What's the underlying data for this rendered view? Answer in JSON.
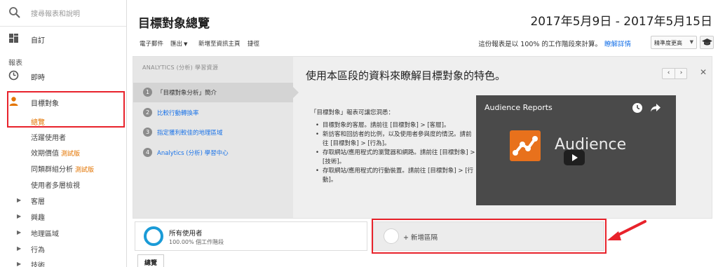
{
  "sidebar": {
    "search_placeholder": "搜尋報表和說明",
    "custom_label": "自訂",
    "section_reports": "報表",
    "realtime_label": "即時",
    "audience_label": "目標對象",
    "audience_items": [
      {
        "label": "總覽",
        "active": true
      },
      {
        "label": "活躍使用者"
      },
      {
        "label": "效期價值",
        "badge": "測試版"
      },
      {
        "label": "同類群組分析",
        "badge": "測試版"
      },
      {
        "label": "使用者多層檢視"
      }
    ],
    "expandable": [
      "客層",
      "興趣",
      "地理區域",
      "行為",
      "技術"
    ]
  },
  "header": {
    "title": "目標對象總覽",
    "date_range": "2017年5月9日 - 2017年5月15日"
  },
  "toolbar": {
    "email": "電子郵件",
    "export": "匯出",
    "add_dashboard": "新增至資訊主頁",
    "shortcut": "捷徑",
    "info_text": "這份報表是以 100% 的工作階段來計算。",
    "info_link": "瞭解詳情",
    "precision_select": "精準度更高"
  },
  "learning": {
    "header": "ANALYTICS (分析) 學習資源",
    "steps": [
      {
        "num": "1",
        "label": "「目標對象分析」簡介",
        "active": true
      },
      {
        "num": "2",
        "label": "比較行動轉換率"
      },
      {
        "num": "3",
        "label": "指定獲利較佳的地理區域"
      },
      {
        "num": "4",
        "label": "Analytics (分析) 學習中心"
      }
    ],
    "title": "使用本區段的資料來瞭解目標對象的特色。",
    "intro": "「目標對象」報表可讓您洞悉：",
    "bullets": [
      "目標對象的客層。請前往 [目標對象] > [客層]。",
      "新訪客和回訪者的比例，以及使用者參與度的情況。請前往 [目標對象] > [行為]。",
      "存取網站/應用程式的瀏覽器和網路。請前往 [目標對象] > [技術]。",
      "存取網站/應用程式的行動裝置。請前往 [目標對象] > [行動]。"
    ],
    "pager_prev": "‹",
    "pager_next": "›",
    "close": "✕",
    "video": {
      "title": "Audience Reports",
      "overlay_word": "Audience"
    }
  },
  "segments": {
    "all_users": "所有使用者",
    "all_users_sub": "100.00% 個工作階段",
    "add_segment": "+ 新增區隔"
  },
  "tabs": {
    "overview": "總覽"
  },
  "colors": {
    "annotation_red": "#e8222b",
    "link_blue": "#1a73e8",
    "active_orange": "#e37400",
    "segment_ring": "#1a9bd7"
  }
}
